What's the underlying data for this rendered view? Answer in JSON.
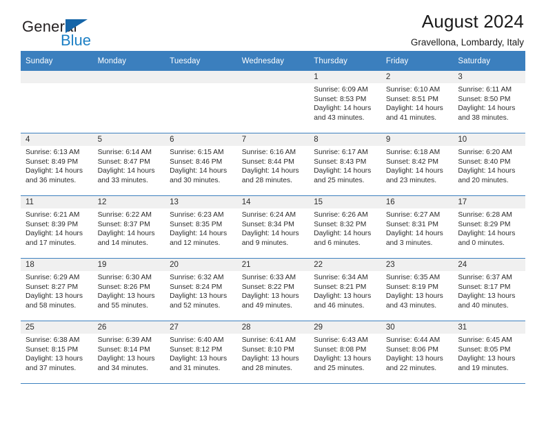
{
  "brand": {
    "name_part1": "General",
    "name_part2": "Blue",
    "sail_color": "#1565a8",
    "blue_color": "#1c7fc4"
  },
  "header": {
    "title": "August 2024",
    "subtitle": "Gravellona, Lombardy, Italy"
  },
  "theme": {
    "header_bg": "#3b7fbe",
    "daynum_bg": "#f0f0f0",
    "row_divider": "#3b7fbe"
  },
  "weekday_headers": [
    "Sunday",
    "Monday",
    "Tuesday",
    "Wednesday",
    "Thursday",
    "Friday",
    "Saturday"
  ],
  "labels": {
    "sunrise": "Sunrise:",
    "sunset": "Sunset:",
    "daylight": "Daylight:"
  },
  "weeks": [
    [
      {
        "day": "",
        "empty": true
      },
      {
        "day": "",
        "empty": true
      },
      {
        "day": "",
        "empty": true
      },
      {
        "day": "",
        "empty": true
      },
      {
        "day": "1",
        "sunrise": "Sunrise: 6:09 AM",
        "sunset": "Sunset: 8:53 PM",
        "daylight": "Daylight: 14 hours and 43 minutes."
      },
      {
        "day": "2",
        "sunrise": "Sunrise: 6:10 AM",
        "sunset": "Sunset: 8:51 PM",
        "daylight": "Daylight: 14 hours and 41 minutes."
      },
      {
        "day": "3",
        "sunrise": "Sunrise: 6:11 AM",
        "sunset": "Sunset: 8:50 PM",
        "daylight": "Daylight: 14 hours and 38 minutes."
      }
    ],
    [
      {
        "day": "4",
        "sunrise": "Sunrise: 6:13 AM",
        "sunset": "Sunset: 8:49 PM",
        "daylight": "Daylight: 14 hours and 36 minutes."
      },
      {
        "day": "5",
        "sunrise": "Sunrise: 6:14 AM",
        "sunset": "Sunset: 8:47 PM",
        "daylight": "Daylight: 14 hours and 33 minutes."
      },
      {
        "day": "6",
        "sunrise": "Sunrise: 6:15 AM",
        "sunset": "Sunset: 8:46 PM",
        "daylight": "Daylight: 14 hours and 30 minutes."
      },
      {
        "day": "7",
        "sunrise": "Sunrise: 6:16 AM",
        "sunset": "Sunset: 8:44 PM",
        "daylight": "Daylight: 14 hours and 28 minutes."
      },
      {
        "day": "8",
        "sunrise": "Sunrise: 6:17 AM",
        "sunset": "Sunset: 8:43 PM",
        "daylight": "Daylight: 14 hours and 25 minutes."
      },
      {
        "day": "9",
        "sunrise": "Sunrise: 6:18 AM",
        "sunset": "Sunset: 8:42 PM",
        "daylight": "Daylight: 14 hours and 23 minutes."
      },
      {
        "day": "10",
        "sunrise": "Sunrise: 6:20 AM",
        "sunset": "Sunset: 8:40 PM",
        "daylight": "Daylight: 14 hours and 20 minutes."
      }
    ],
    [
      {
        "day": "11",
        "sunrise": "Sunrise: 6:21 AM",
        "sunset": "Sunset: 8:39 PM",
        "daylight": "Daylight: 14 hours and 17 minutes."
      },
      {
        "day": "12",
        "sunrise": "Sunrise: 6:22 AM",
        "sunset": "Sunset: 8:37 PM",
        "daylight": "Daylight: 14 hours and 14 minutes."
      },
      {
        "day": "13",
        "sunrise": "Sunrise: 6:23 AM",
        "sunset": "Sunset: 8:35 PM",
        "daylight": "Daylight: 14 hours and 12 minutes."
      },
      {
        "day": "14",
        "sunrise": "Sunrise: 6:24 AM",
        "sunset": "Sunset: 8:34 PM",
        "daylight": "Daylight: 14 hours and 9 minutes."
      },
      {
        "day": "15",
        "sunrise": "Sunrise: 6:26 AM",
        "sunset": "Sunset: 8:32 PM",
        "daylight": "Daylight: 14 hours and 6 minutes."
      },
      {
        "day": "16",
        "sunrise": "Sunrise: 6:27 AM",
        "sunset": "Sunset: 8:31 PM",
        "daylight": "Daylight: 14 hours and 3 minutes."
      },
      {
        "day": "17",
        "sunrise": "Sunrise: 6:28 AM",
        "sunset": "Sunset: 8:29 PM",
        "daylight": "Daylight: 14 hours and 0 minutes."
      }
    ],
    [
      {
        "day": "18",
        "sunrise": "Sunrise: 6:29 AM",
        "sunset": "Sunset: 8:27 PM",
        "daylight": "Daylight: 13 hours and 58 minutes."
      },
      {
        "day": "19",
        "sunrise": "Sunrise: 6:30 AM",
        "sunset": "Sunset: 8:26 PM",
        "daylight": "Daylight: 13 hours and 55 minutes."
      },
      {
        "day": "20",
        "sunrise": "Sunrise: 6:32 AM",
        "sunset": "Sunset: 8:24 PM",
        "daylight": "Daylight: 13 hours and 52 minutes."
      },
      {
        "day": "21",
        "sunrise": "Sunrise: 6:33 AM",
        "sunset": "Sunset: 8:22 PM",
        "daylight": "Daylight: 13 hours and 49 minutes."
      },
      {
        "day": "22",
        "sunrise": "Sunrise: 6:34 AM",
        "sunset": "Sunset: 8:21 PM",
        "daylight": "Daylight: 13 hours and 46 minutes."
      },
      {
        "day": "23",
        "sunrise": "Sunrise: 6:35 AM",
        "sunset": "Sunset: 8:19 PM",
        "daylight": "Daylight: 13 hours and 43 minutes."
      },
      {
        "day": "24",
        "sunrise": "Sunrise: 6:37 AM",
        "sunset": "Sunset: 8:17 PM",
        "daylight": "Daylight: 13 hours and 40 minutes."
      }
    ],
    [
      {
        "day": "25",
        "sunrise": "Sunrise: 6:38 AM",
        "sunset": "Sunset: 8:15 PM",
        "daylight": "Daylight: 13 hours and 37 minutes."
      },
      {
        "day": "26",
        "sunrise": "Sunrise: 6:39 AM",
        "sunset": "Sunset: 8:14 PM",
        "daylight": "Daylight: 13 hours and 34 minutes."
      },
      {
        "day": "27",
        "sunrise": "Sunrise: 6:40 AM",
        "sunset": "Sunset: 8:12 PM",
        "daylight": "Daylight: 13 hours and 31 minutes."
      },
      {
        "day": "28",
        "sunrise": "Sunrise: 6:41 AM",
        "sunset": "Sunset: 8:10 PM",
        "daylight": "Daylight: 13 hours and 28 minutes."
      },
      {
        "day": "29",
        "sunrise": "Sunrise: 6:43 AM",
        "sunset": "Sunset: 8:08 PM",
        "daylight": "Daylight: 13 hours and 25 minutes."
      },
      {
        "day": "30",
        "sunrise": "Sunrise: 6:44 AM",
        "sunset": "Sunset: 8:06 PM",
        "daylight": "Daylight: 13 hours and 22 minutes."
      },
      {
        "day": "31",
        "sunrise": "Sunrise: 6:45 AM",
        "sunset": "Sunset: 8:05 PM",
        "daylight": "Daylight: 13 hours and 19 minutes."
      }
    ]
  ]
}
